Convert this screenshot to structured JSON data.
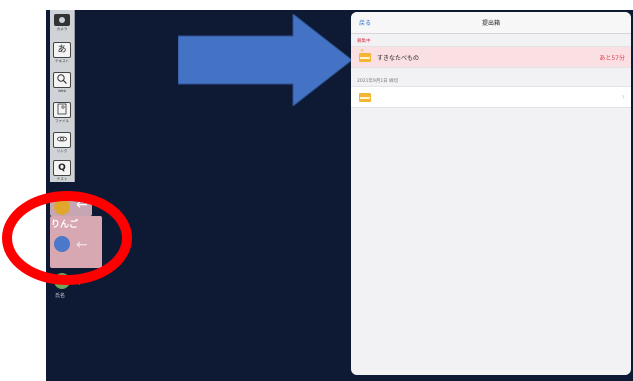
{
  "toolbar": {
    "items": [
      {
        "icon": "camera-icon",
        "glyph": "",
        "label": "カメラ"
      },
      {
        "icon": "text-icon",
        "glyph": "あ",
        "label": "テキスト"
      },
      {
        "icon": "web-search-icon",
        "glyph": "",
        "label": "Web"
      },
      {
        "icon": "file-icon",
        "glyph": "",
        "label": "ファイル"
      },
      {
        "icon": "link-icon",
        "glyph": "",
        "label": "リンク"
      },
      {
        "icon": "quiz-icon",
        "glyph": "Q",
        "label": "テスト"
      }
    ]
  },
  "canvas_cards": {
    "card_label": "りんご",
    "student_label": "氏名"
  },
  "panel": {
    "back": "戻る",
    "title": "提出箱",
    "open_section": "募集中",
    "open_item": {
      "name": "すきなたべもの",
      "remaining": "あと57分"
    },
    "closed_section": "2021年9月1日 締切",
    "closed_item": {
      "name": ""
    }
  },
  "colors": {
    "canvas": "#0e1a33",
    "blue_arrow": "#4472c4",
    "red_ring": "#ff0000",
    "accent_red": "#d9374b",
    "link_blue": "#2f6fd6"
  }
}
